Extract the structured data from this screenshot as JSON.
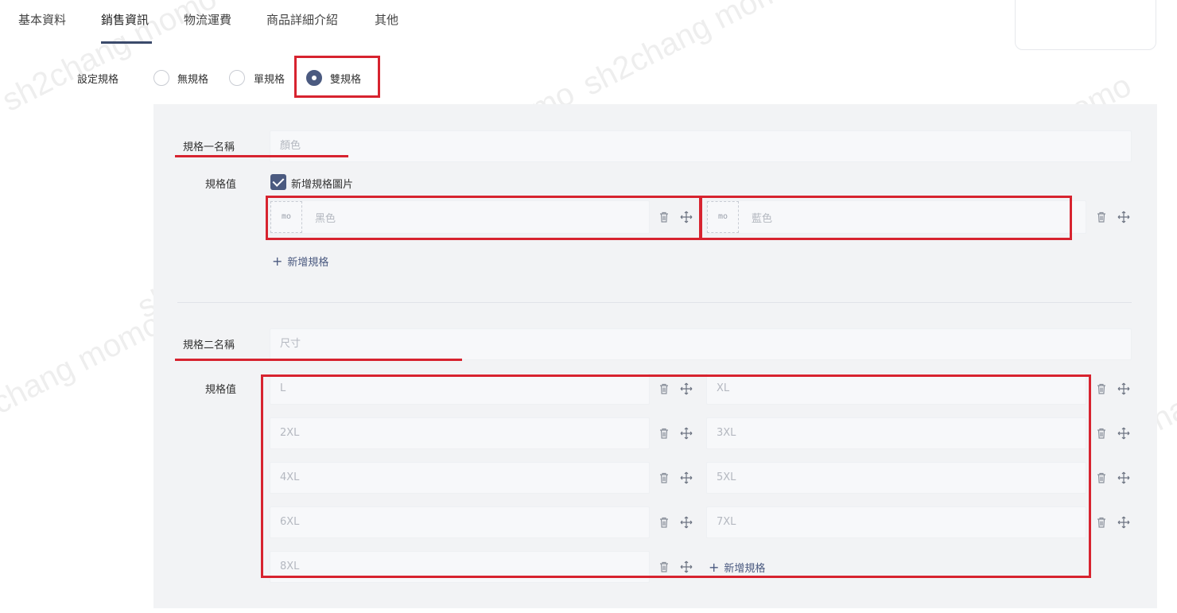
{
  "tabs": [
    {
      "label": "基本資料"
    },
    {
      "label": "銷售資訊",
      "active": true
    },
    {
      "label": "物流運費"
    },
    {
      "label": "商品詳細介紹"
    },
    {
      "label": "其他"
    }
  ],
  "spec_setting": {
    "label": "設定規格",
    "options": [
      "無規格",
      "單規格",
      "雙規格"
    ],
    "selected": "雙規格"
  },
  "spec1": {
    "name_label": "規格一名稱",
    "name_placeholder": "顏色",
    "values_label": "規格值",
    "add_image_label": "新增規格圖片",
    "add_image_checked": true,
    "values": [
      "黑色",
      "藍色"
    ],
    "add_button": "新增規格"
  },
  "spec2": {
    "name_label": "規格二名稱",
    "name_placeholder": "尺寸",
    "values_label": "規格值",
    "values": [
      "L",
      "XL",
      "2XL",
      "3XL",
      "4XL",
      "5XL",
      "6XL",
      "7XL",
      "8XL"
    ],
    "add_button": "新增規格"
  },
  "image_slot_icon": "mo-logo-placeholder",
  "icons": {
    "delete": "trash-icon",
    "drag": "move-icon",
    "add": "plus-icon"
  },
  "watermark": "sh2chang momo",
  "colors": {
    "accent": "#4b5a80",
    "annotation": "#d7232f",
    "panel": "#f2f3f5"
  }
}
